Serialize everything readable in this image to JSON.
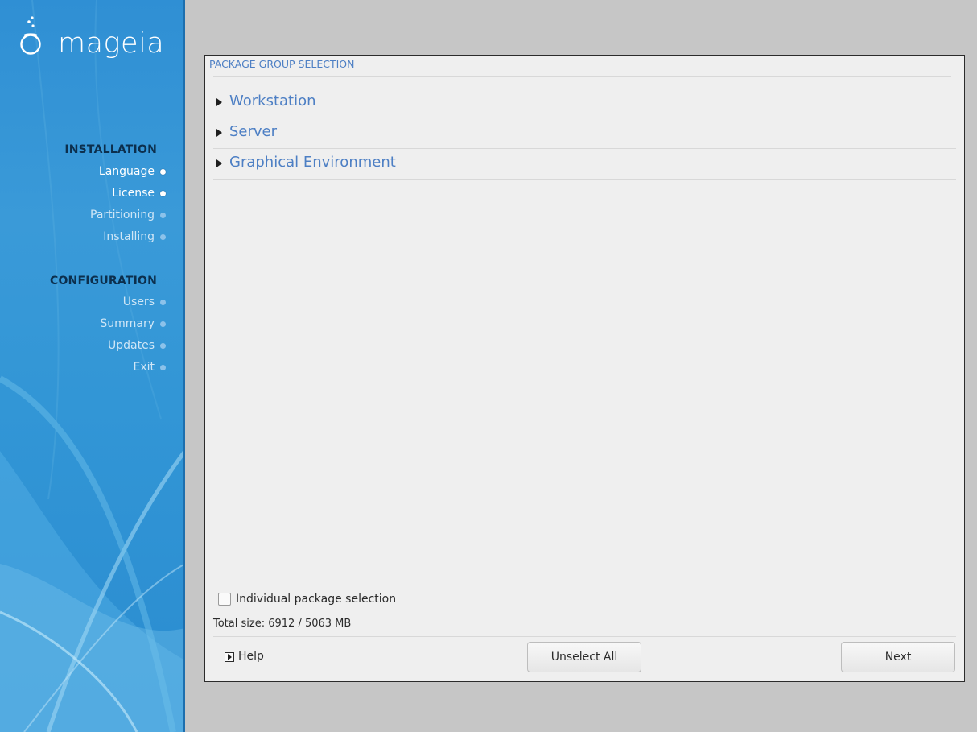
{
  "brand": {
    "logo_text": "mageia",
    "accent_color": "#4d7fc4"
  },
  "sidebar": {
    "sections": [
      {
        "heading": "INSTALLATION",
        "items": [
          {
            "label": "Language",
            "status": "done"
          },
          {
            "label": "License",
            "status": "done"
          },
          {
            "label": "Partitioning",
            "status": "pending"
          },
          {
            "label": "Installing",
            "status": "pending"
          }
        ]
      },
      {
        "heading": "CONFIGURATION",
        "items": [
          {
            "label": "Users",
            "status": "pending"
          },
          {
            "label": "Summary",
            "status": "pending"
          },
          {
            "label": "Updates",
            "status": "pending"
          },
          {
            "label": "Exit",
            "status": "pending"
          }
        ]
      }
    ]
  },
  "main": {
    "title": "PACKAGE GROUP SELECTION",
    "groups": [
      {
        "label": "Workstation",
        "expanded": false
      },
      {
        "label": "Server",
        "expanded": false
      },
      {
        "label": "Graphical Environment",
        "expanded": false
      }
    ],
    "individual_selection": {
      "label": "Individual package selection",
      "checked": false
    },
    "total_size": "Total size: 6912 / 5063 MB",
    "help_label": "Help",
    "unselect_all_label": "Unselect All",
    "next_label": "Next"
  }
}
